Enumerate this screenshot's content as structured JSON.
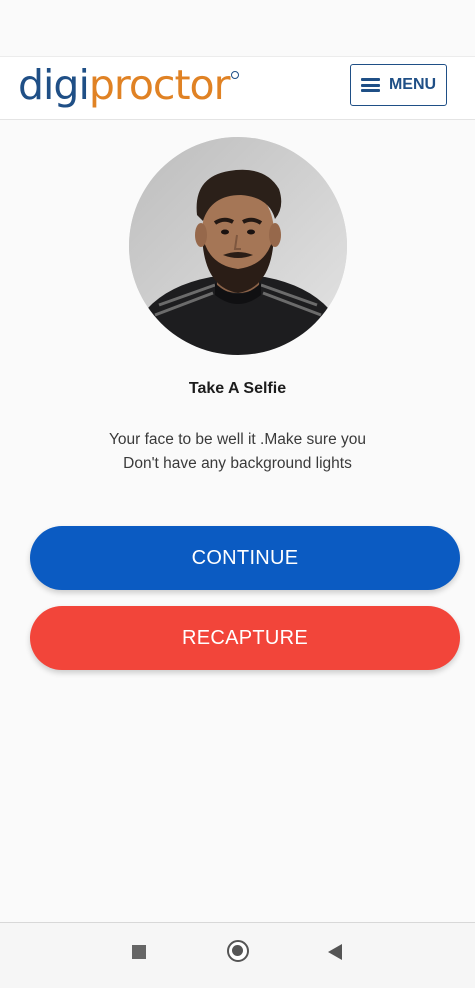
{
  "header": {
    "logo_part_1": "digi",
    "logo_part_2": "proctor",
    "menu_label": "MENU"
  },
  "selfie": {
    "title": "Take A Selfie",
    "instruction_line_1": "Your face to be well it .Make sure you",
    "instruction_line_2": "Don't have any background lights"
  },
  "actions": {
    "continue_label": "CONTINUE",
    "recapture_label": "RECAPTURE"
  },
  "icons": {
    "menu": "hamburger-menu-icon",
    "nav_recents": "square-recents-icon",
    "nav_home": "circle-home-icon",
    "nav_back": "triangle-back-icon"
  },
  "colors": {
    "brand_blue": "#1f4f86",
    "brand_orange": "#e08224",
    "continue_button": "#0b5bc2",
    "recapture_button": "#f2453a"
  }
}
